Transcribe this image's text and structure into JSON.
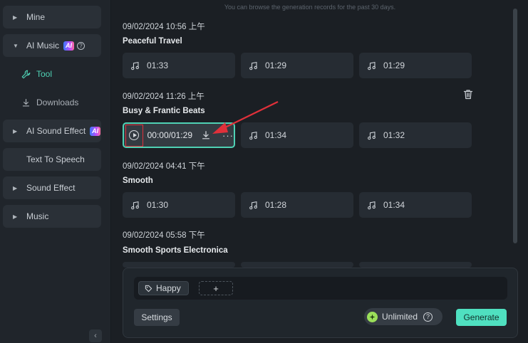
{
  "sidebar": {
    "items": [
      {
        "label": "Mine",
        "expand": "collapsed"
      },
      {
        "label": "AI Music",
        "expand": "expanded",
        "badge": "AI"
      },
      {
        "label": "AI Sound Effect",
        "expand": "collapsed",
        "badge": "AI"
      },
      {
        "label": "Text To Speech",
        "expand": "none"
      },
      {
        "label": "Sound Effect",
        "expand": "collapsed"
      },
      {
        "label": "Music",
        "expand": "collapsed"
      }
    ],
    "sub_items": [
      {
        "label": "Tool",
        "icon": "wrench-icon",
        "active": true
      },
      {
        "label": "Downloads",
        "icon": "download-icon",
        "active": false
      }
    ],
    "collapse_glyph": "‹"
  },
  "main": {
    "hint": "You can browse the generation records for the past 30 days.",
    "groups": [
      {
        "date": "09/02/2024 10:56 上午",
        "title": "Peaceful Travel",
        "tracks": [
          "01:33",
          "01:29",
          "01:29"
        ]
      },
      {
        "date": "09/02/2024 11:26 上午",
        "title": "Busy & Frantic Beats",
        "playing_time": "00:00/01:29",
        "tracks": [
          "01:34",
          "01:32"
        ]
      },
      {
        "date": "09/02/2024 04:41 下午",
        "title": "Smooth",
        "tracks": [
          "01:30",
          "01:28",
          "01:34"
        ]
      },
      {
        "date": "09/02/2024 05:58 下午",
        "title": "Smooth Sports Electronica",
        "tracks": []
      }
    ]
  },
  "panel": {
    "tag": "Happy",
    "add_label": "+",
    "settings_label": "Settings",
    "unlimited_label": "Unlimited",
    "generate_label": "Generate"
  },
  "colors": {
    "accent": "#4fd1b4",
    "generate": "#4fe0c0",
    "highlight": "#e0303a"
  }
}
